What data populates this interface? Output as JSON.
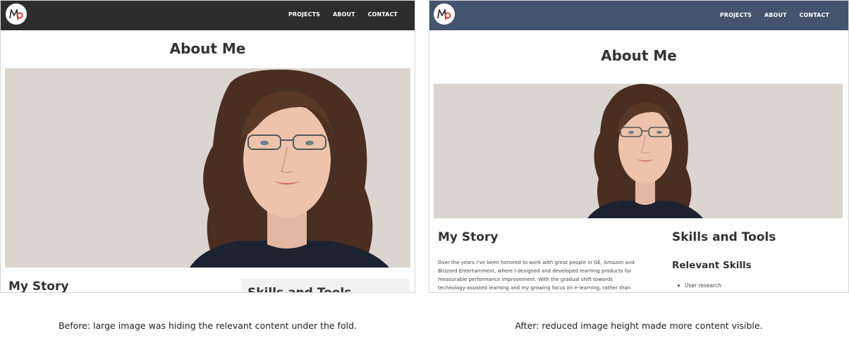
{
  "before": {
    "nav": {
      "logo_text": "MO",
      "links": [
        "PROJECTS",
        "ABOUT",
        "CONTACT"
      ]
    },
    "page_title": "About Me",
    "story_title": "My Story",
    "skills_title": "Skills and Tools"
  },
  "after": {
    "nav": {
      "logo_text": "MO",
      "links": [
        "PROJECTS",
        "ABOUT",
        "CONTACT"
      ]
    },
    "page_title": "About Me",
    "story_title": "My Story",
    "skills_title": "Skills and Tools",
    "relevant_skills_title": "Relevant Skills",
    "story_lines": [
      "Over the years I’ve been honored to work with great people in GE, Amazon and",
      "Blizzard Entertainment, where I designed and developed learning products for",
      "measurable performance improvement. With the gradual shift towards",
      "technology-assisted learning and my growing focus on e-learning, rather than"
    ],
    "skills": [
      "User research"
    ]
  },
  "captions": {
    "before": "Before: large image was hiding the relevant content under the fold.",
    "after": "After: reduced image height made more content visible."
  },
  "colors": {
    "before_nav": "#2d2d2d",
    "after_nav": "#44546f",
    "hero_bg": "#dad5cf",
    "logo_accent": "#d8302a"
  },
  "icons": {
    "logo": "mo-monogram-logo",
    "hero": "portrait-photo"
  }
}
